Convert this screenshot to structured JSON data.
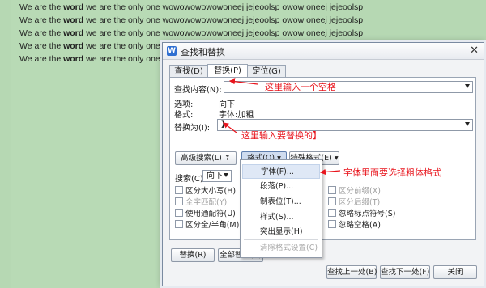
{
  "document": {
    "lines": [
      {
        "pre": "We are the ",
        "bold": "word",
        "post": " we are the only  one wowowowowowoneej jejeoolsp owow oneej jejeoolsp"
      },
      {
        "pre": "We are the ",
        "bold": "word",
        "post": " we are the only  one wowowowowowoneej jejeoolsp owow oneej jejeoolsp"
      },
      {
        "pre": "We are the ",
        "bold": "word",
        "post": " we are the only  one wowowowowowoneej jejeoolsp owow oneej jejeoolsp"
      },
      {
        "pre": "We are the ",
        "bold": "word",
        "post": " we are the only  one wowowowowowoneej jejeoolsp owow oneej jejeoolsp"
      },
      {
        "pre": "We are the ",
        "bold": "word",
        "post": " we are the only  one wowow"
      }
    ]
  },
  "dialog": {
    "title": "查找和替换",
    "app_icon_letter": "W",
    "close_glyph": "✕",
    "tabs": [
      {
        "label": "查找(D)"
      },
      {
        "label": "替换(P)"
      },
      {
        "label": "定位(G)"
      }
    ],
    "find_label": "查找内容(N):",
    "find_value": "",
    "options_label": "选项:",
    "options_value": "向下",
    "format_label": "格式:",
    "format_value": "字体:加粗",
    "replace_label": "替换为(I):",
    "replace_value": "】",
    "buttons": {
      "advanced": "高级搜索(L) ⇡",
      "format": "格式(O) ▾",
      "special": "特殊格式(E) ▾",
      "replace": "替换(R)",
      "replace_all": "全部替换(A)",
      "find_prev": "查找上一处(B)",
      "find_next": "查找下一处(F)",
      "close": "关闭"
    },
    "search_label": "搜索(C)",
    "search_value": "向下",
    "checkboxes": {
      "match_case": "区分大小写(H)",
      "whole_word": "全字匹配(Y)",
      "wildcards": "使用通配符(U)",
      "full_half": "区分全/半角(M)",
      "prefix": "区分前缀(X)",
      "suffix": "区分后缀(T)",
      "ignore_punct": "忽略标点符号(S)",
      "ignore_space": "忽略空格(A)"
    },
    "format_menu": [
      {
        "label": "字体(F)..."
      },
      {
        "label": "段落(P)..."
      },
      {
        "label": "制表位(T)..."
      },
      {
        "label": "样式(S)..."
      },
      {
        "label": "突出显示(H)"
      },
      {
        "label": "清除格式设置(C)"
      }
    ]
  },
  "annotations": {
    "find_note": "这里输入一个空格",
    "replace_note": "这里输入要替换的】",
    "format_note": "字体里面要选择粗体格式",
    "color": "#e8141c"
  }
}
